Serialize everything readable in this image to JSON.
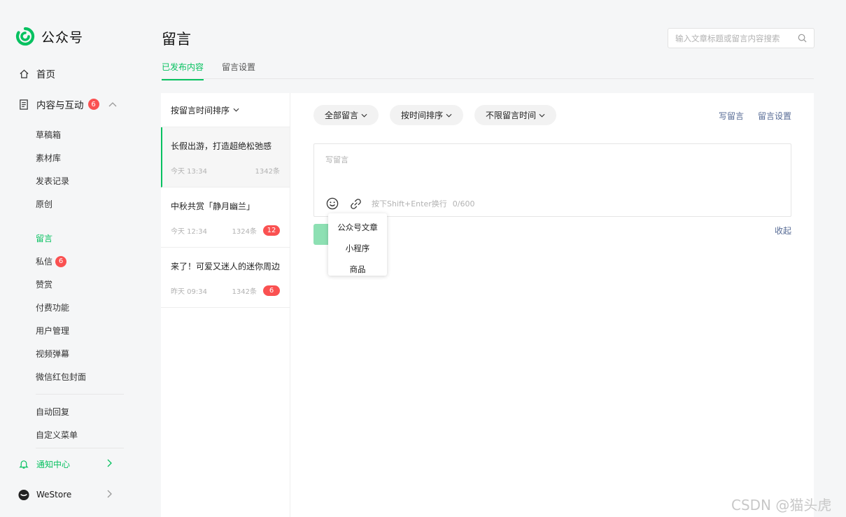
{
  "brand": {
    "name": "公众号",
    "accent": "#07c160"
  },
  "sidebar": {
    "home": {
      "label": "首页",
      "icon": "home-icon"
    },
    "content": {
      "label": "内容与互动",
      "badge": "6",
      "icon": "document-icon"
    },
    "content_items": [
      "草稿箱",
      "素材库",
      "发表记录",
      "原创"
    ],
    "interact_items": [
      {
        "label": "留言",
        "active": true
      },
      {
        "label": "私信",
        "badge": "6"
      },
      {
        "label": "赞赏"
      },
      {
        "label": "付费功能"
      },
      {
        "label": "用户管理"
      },
      {
        "label": "视频弹幕"
      },
      {
        "label": "微信红包封面"
      }
    ],
    "auto_items": [
      "自动回复",
      "自定义菜单"
    ],
    "notification": {
      "label": "通知中心",
      "icon": "bell-icon"
    },
    "westore": {
      "label": "WeStore"
    }
  },
  "header": {
    "title": "留言",
    "search_placeholder": "输入文章标题或留言内容搜索"
  },
  "tabs": [
    {
      "label": "已发布内容",
      "active": true
    },
    {
      "label": "留言设置",
      "active": false
    }
  ],
  "list": {
    "sort_label": "按留言时间排序",
    "articles": [
      {
        "title": "长假出游，打造超绝松弛感",
        "time": "今天 13:34",
        "count": "1342条",
        "badge": ""
      },
      {
        "title": "中秋共赏「静月幽兰」",
        "time": "今天 12:34",
        "count": "1324条",
        "badge": "12"
      },
      {
        "title": "来了！可爱又迷人的迷你周边",
        "time": "昨天 09:34",
        "count": "1342条",
        "badge": "6"
      }
    ]
  },
  "filters": {
    "all": "全部留言",
    "sort": "按时间排序",
    "time": "不限留言时间"
  },
  "actions": {
    "write": "写留言",
    "settings": "留言设置"
  },
  "editor": {
    "placeholder": "写留言",
    "hint": "按下Shift+Enter换行",
    "counter": "0/600",
    "collapse": "收起"
  },
  "link_menu": [
    "公众号文章",
    "小程序",
    "商品"
  ],
  "watermark": "CSDN @猫头虎"
}
